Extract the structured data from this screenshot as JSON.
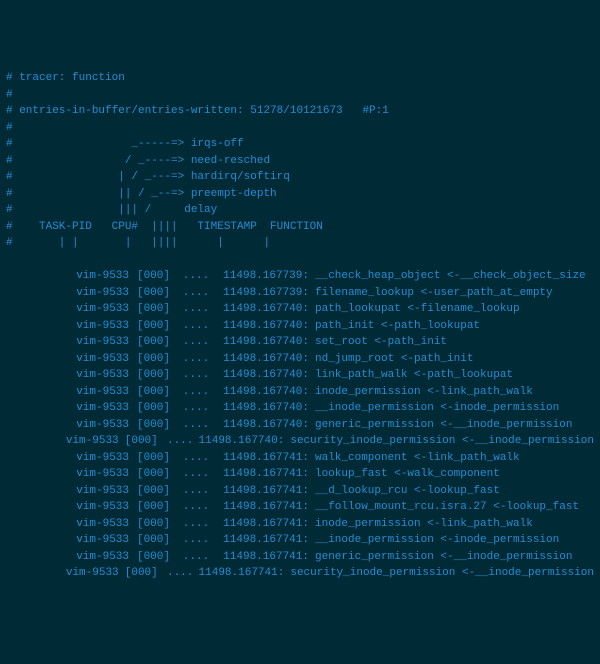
{
  "header": {
    "lines": [
      "# tracer: function",
      "#",
      "# entries-in-buffer/entries-written: 51278/10121673   #P:1",
      "#",
      "#                  _-----=> irqs-off",
      "#                 / _----=> need-resched",
      "#                | / _---=> hardirq/softirq",
      "#                || / _--=> preempt-depth",
      "#                ||| /     delay",
      "#    TASK-PID   CPU#  ||||   TIMESTAMP  FUNCTION",
      "#       | |       |   ||||      |      |"
    ]
  },
  "rows": [
    {
      "task": "vim-9533",
      "cpu": "[000]",
      "flags": "....",
      "ts": "11498.167739:",
      "func": "__check_heap_object <-__check_object_size"
    },
    {
      "task": "vim-9533",
      "cpu": "[000]",
      "flags": "....",
      "ts": "11498.167739:",
      "func": "filename_lookup <-user_path_at_empty"
    },
    {
      "task": "vim-9533",
      "cpu": "[000]",
      "flags": "....",
      "ts": "11498.167740:",
      "func": "path_lookupat <-filename_lookup"
    },
    {
      "task": "vim-9533",
      "cpu": "[000]",
      "flags": "....",
      "ts": "11498.167740:",
      "func": "path_init <-path_lookupat"
    },
    {
      "task": "vim-9533",
      "cpu": "[000]",
      "flags": "....",
      "ts": "11498.167740:",
      "func": "set_root <-path_init"
    },
    {
      "task": "vim-9533",
      "cpu": "[000]",
      "flags": "....",
      "ts": "11498.167740:",
      "func": "nd_jump_root <-path_init"
    },
    {
      "task": "vim-9533",
      "cpu": "[000]",
      "flags": "....",
      "ts": "11498.167740:",
      "func": "link_path_walk <-path_lookupat"
    },
    {
      "task": "vim-9533",
      "cpu": "[000]",
      "flags": "....",
      "ts": "11498.167740:",
      "func": "inode_permission <-link_path_walk"
    },
    {
      "task": "vim-9533",
      "cpu": "[000]",
      "flags": "....",
      "ts": "11498.167740:",
      "func": "__inode_permission <-inode_permission"
    },
    {
      "task": "vim-9533",
      "cpu": "[000]",
      "flags": "....",
      "ts": "11498.167740:",
      "func": "generic_permission <-__inode_permission"
    },
    {
      "task": "vim-9533",
      "cpu": "[000]",
      "flags": "....",
      "ts": "11498.167740:",
      "func": "security_inode_permission <-__inode_permission"
    },
    {
      "task": "vim-9533",
      "cpu": "[000]",
      "flags": "....",
      "ts": "11498.167741:",
      "func": "walk_component <-link_path_walk"
    },
    {
      "task": "vim-9533",
      "cpu": "[000]",
      "flags": "....",
      "ts": "11498.167741:",
      "func": "lookup_fast <-walk_component"
    },
    {
      "task": "vim-9533",
      "cpu": "[000]",
      "flags": "....",
      "ts": "11498.167741:",
      "func": "__d_lookup_rcu <-lookup_fast"
    },
    {
      "task": "vim-9533",
      "cpu": "[000]",
      "flags": "....",
      "ts": "11498.167741:",
      "func": "__follow_mount_rcu.isra.27 <-lookup_fast"
    },
    {
      "task": "vim-9533",
      "cpu": "[000]",
      "flags": "....",
      "ts": "11498.167741:",
      "func": "inode_permission <-link_path_walk"
    },
    {
      "task": "vim-9533",
      "cpu": "[000]",
      "flags": "....",
      "ts": "11498.167741:",
      "func": "__inode_permission <-inode_permission"
    },
    {
      "task": "vim-9533",
      "cpu": "[000]",
      "flags": "....",
      "ts": "11498.167741:",
      "func": "generic_permission <-__inode_permission"
    },
    {
      "task": "vim-9533",
      "cpu": "[000]",
      "flags": "....",
      "ts": "11498.167741:",
      "func": "security_inode_permission <-__inode_permission"
    }
  ]
}
